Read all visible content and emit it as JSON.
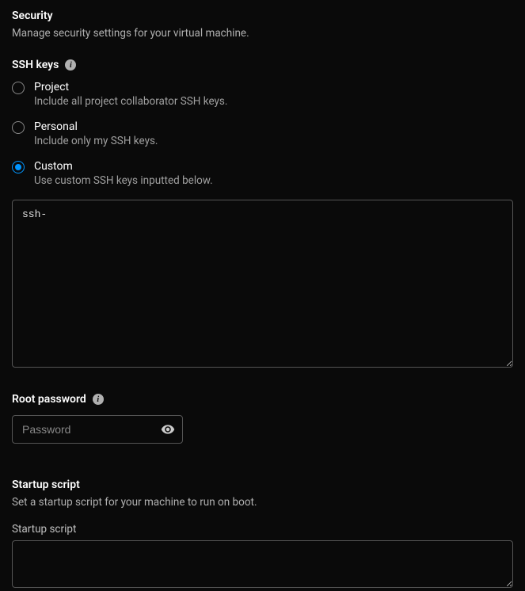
{
  "security": {
    "title": "Security",
    "desc": "Manage security settings for your virtual machine."
  },
  "ssh": {
    "label": "SSH keys",
    "options": [
      {
        "title": "Project",
        "desc": "Include all project collaborator SSH keys.",
        "selected": false
      },
      {
        "title": "Personal",
        "desc": "Include only my SSH keys.",
        "selected": false
      },
      {
        "title": "Custom",
        "desc": "Use custom SSH keys inputted below.",
        "selected": true
      }
    ],
    "textarea_value": "ssh-"
  },
  "root_password": {
    "label": "Root password",
    "placeholder": "Password",
    "value": ""
  },
  "startup": {
    "title": "Startup script",
    "desc": "Set a startup script for your machine to run on boot.",
    "field_label": "Startup script",
    "value": ""
  }
}
